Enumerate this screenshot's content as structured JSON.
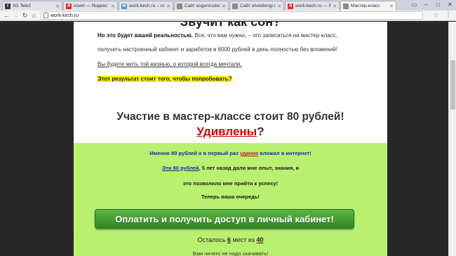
{
  "browser": {
    "tabs": [
      {
        "title": "3G Tele2",
        "icon": "t2"
      },
      {
        "title": "vovet — Яндекс: н",
        "icon": "ya"
      },
      {
        "title": "work-kech.ru – отз",
        "icon": "w"
      },
      {
        "title": "Сайт eugenrocket",
        "icon": "doc"
      },
      {
        "title": "Сайт otvetdengi.ru",
        "icon": "doc"
      },
      {
        "title": "work-kech.ru — Я",
        "icon": "ya"
      },
      {
        "title": "Мастер-класс",
        "icon": "doc"
      }
    ],
    "active_tab": 6,
    "url": "work-kech.ru"
  },
  "page": {
    "heading_cut": "Звучит как сон?",
    "p1_bold": "Но это будет вашей реальностью.",
    "p1_rest": " Все, что вам нужно, – это записаться на мастер-класс,",
    "p2": "получить настроенный кабинет и заработок в 6000 рублей в день полностью без вложений!",
    "p3": "Вы будете жить той жизнью, о которой всегда мечтали.",
    "highlight": "Этот результат стоит того, чтобы попробовать?",
    "price": "Участие в мастер-классе стоит 80 рублей!",
    "surprised": "Удивлены",
    "surprised_q": "?",
    "g1_pre": "Именно 80 рублей я в первый раз ",
    "g1_red": "удачно",
    "g1_post": " вложил в интернет!",
    "g2_link": "Эти 80 рублей",
    "g2_rest": ", 5 лет назад дали мне опыт, знания, и",
    "g3": "это позволило мне прийти к успеху!",
    "g4": "Теперь ваша очередь!",
    "cta": "Оплатить и получить доступ в личный кабинет!",
    "remain_pre": "Осталось ",
    "remain_n": "6",
    "remain_mid": " мест из ",
    "remain_total": "40",
    "more": "Вам ничего не надо скачивать!"
  }
}
